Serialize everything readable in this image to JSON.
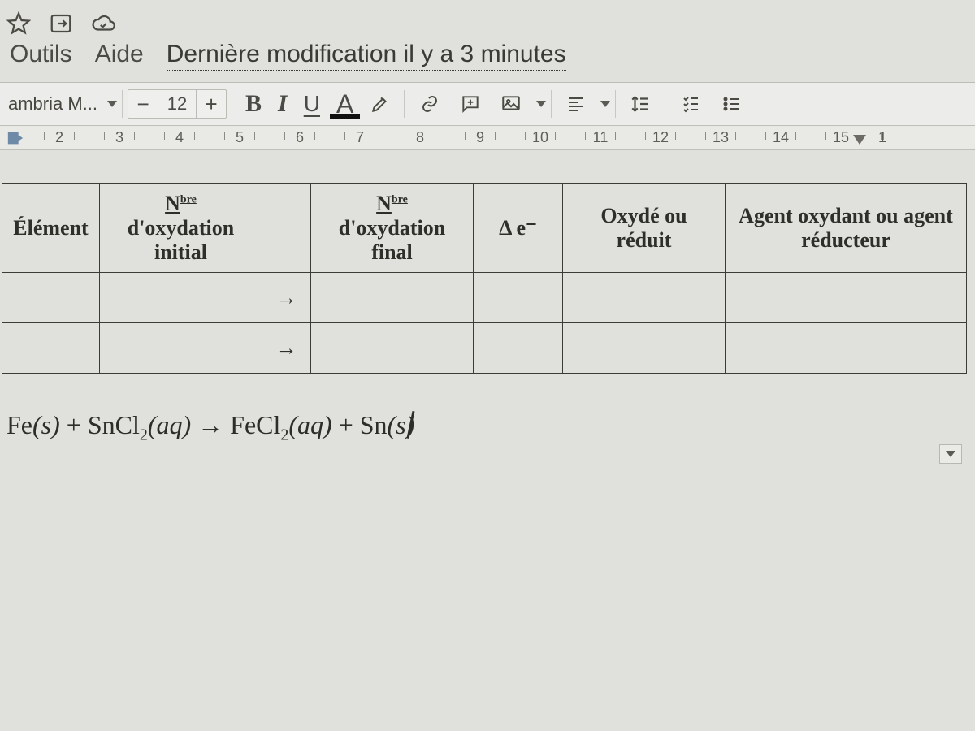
{
  "menu": {
    "outils": "Outils",
    "aide": "Aide"
  },
  "last_modification": "Dernière modification il y a 3 minutes",
  "toolbar": {
    "font_name": "ambria M...",
    "font_size": "12",
    "minus": "−",
    "plus": "+",
    "bold": "B",
    "italic": "I",
    "underline": "U",
    "text_color": "A"
  },
  "ruler": {
    "marks": [
      "2",
      "3",
      "4",
      "5",
      "6",
      "7",
      "8",
      "9",
      "10",
      "11",
      "12",
      "13",
      "14",
      "15",
      "1"
    ]
  },
  "table": {
    "headers": {
      "element": "Élément",
      "nox_initial_prefix_N": "N",
      "nox_initial_sup": "bre",
      "nox_initial_line2": "d'oxydation initial",
      "nox_final_prefix_N": "N",
      "nox_final_sup": "bre",
      "nox_final_line2": "d'oxydation final",
      "delta_e": "Δ e⁻",
      "oxy_reduit": "Oxydé ou réduit",
      "agent": "Agent oxydant ou agent réducteur"
    },
    "arrow": "→",
    "rows": [
      {
        "col1": "",
        "col2": "",
        "col3": "→",
        "col4": "",
        "col5": "",
        "col6": "",
        "col7": ""
      },
      {
        "col1": "",
        "col2": "",
        "col3": "→",
        "col4": "",
        "col5": "",
        "col6": "",
        "col7": ""
      }
    ]
  },
  "equation": {
    "lhs1": "Fe",
    "lhs1_state": "(s)",
    "plus": " + ",
    "lhs2": "SnCl",
    "lhs2_sub": "2",
    "lhs2_state": "(aq)",
    "arrow": " → ",
    "rhs1": "FeCl",
    "rhs1_sub": "2",
    "rhs1_state": "(aq)",
    "rhs2": "Sn",
    "rhs2_state": "(s)"
  }
}
